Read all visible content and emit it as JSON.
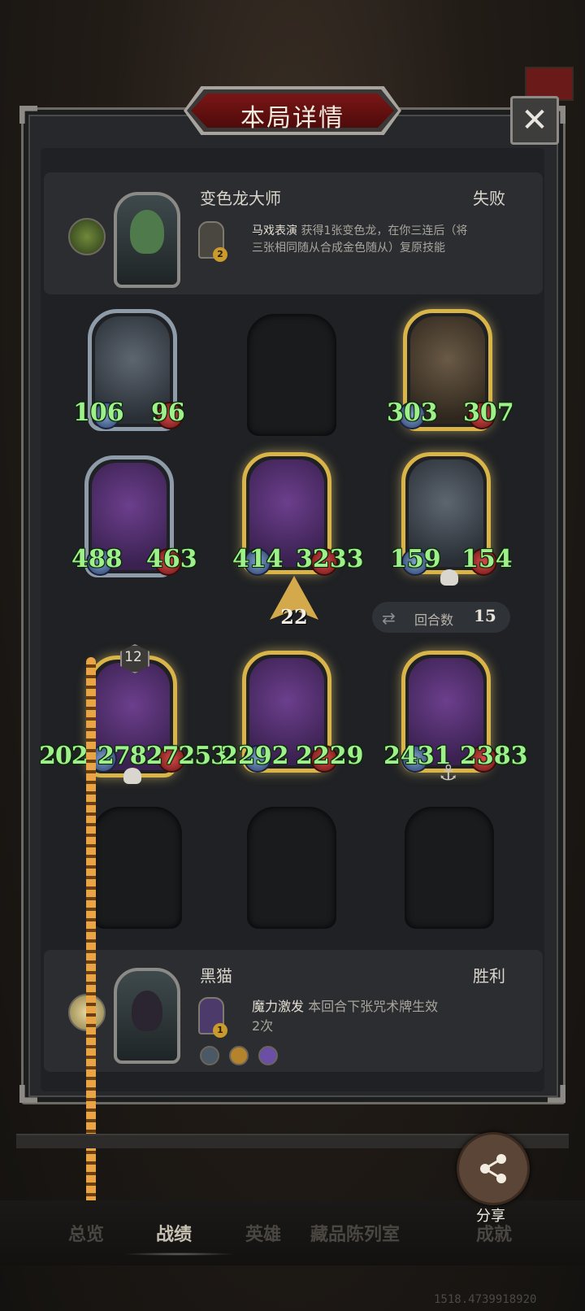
{
  "dialog": {
    "title": "本局详情",
    "close_icon": "close-icon"
  },
  "opponent": {
    "name": "变色龙大师",
    "result": "失败",
    "skill_cost": "2",
    "skill_name": "马戏表演",
    "skill_desc_line1": "获得1张变色龙，在你三连后（将",
    "skill_desc_line2": "三张相同随从合成金色随从）复原技能"
  },
  "opponent_board": [
    {
      "atk": "106",
      "hp": "96",
      "frame": "silver"
    },
    {
      "empty": true
    },
    {
      "atk": "303",
      "hp": "307",
      "frame": "gold"
    }
  ],
  "board_row2": [
    {
      "atk": "488",
      "hp": "463",
      "frame": "silver"
    },
    {
      "atk": "414",
      "hp": "3233",
      "frame": "gold"
    },
    {
      "atk": "159",
      "hp": "154",
      "frame": "gold"
    }
  ],
  "level": "22",
  "round": {
    "label": "回合数",
    "value": "15"
  },
  "player_board": [
    {
      "atk": "202",
      "hp": "27827253",
      "tier": "12",
      "frame": "gold"
    },
    {
      "atk": "2292",
      "hp": "2229",
      "frame": "gold"
    },
    {
      "atk": "2431",
      "hp": "2383",
      "frame": "gold"
    }
  ],
  "player": {
    "name": "黑猫",
    "result": "胜利",
    "skill_cost": "1",
    "skill_name": "魔力激发",
    "skill_desc_line1": "本回合下张咒术牌生效",
    "skill_desc_line2": "2次"
  },
  "share": {
    "label": "分享"
  },
  "nav": {
    "items": [
      "总览",
      "战绩",
      "英雄",
      "藏品陈列室",
      "成就"
    ],
    "active": "战绩"
  },
  "debug_coord": "1518.4739918920"
}
